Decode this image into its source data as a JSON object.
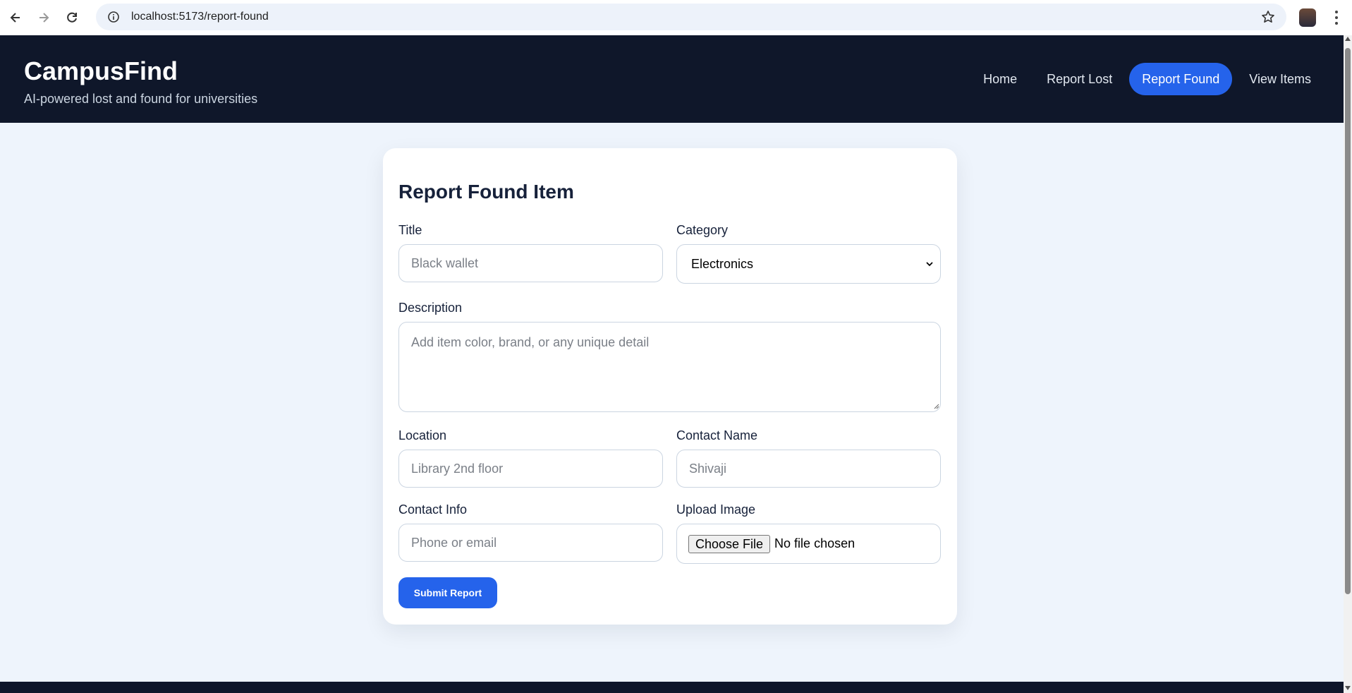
{
  "browser": {
    "url": "localhost:5173/report-found"
  },
  "header": {
    "brand": "CampusFind",
    "tagline": "AI-powered lost and found for universities",
    "nav": [
      {
        "label": "Home",
        "active": false
      },
      {
        "label": "Report Lost",
        "active": false
      },
      {
        "label": "Report Found",
        "active": true
      },
      {
        "label": "View Items",
        "active": false
      }
    ]
  },
  "form": {
    "heading": "Report Found Item",
    "title": {
      "label": "Title",
      "placeholder": "Black wallet"
    },
    "category": {
      "label": "Category",
      "value": "Electronics"
    },
    "description": {
      "label": "Description",
      "placeholder": "Add item color, brand, or any unique detail"
    },
    "location": {
      "label": "Location",
      "placeholder": "Library 2nd floor"
    },
    "contact_name": {
      "label": "Contact Name",
      "placeholder": "Shivaji"
    },
    "contact_info": {
      "label": "Contact Info",
      "placeholder": "Phone or email"
    },
    "upload": {
      "label": "Upload Image",
      "button": "Choose File",
      "status": "No file chosen"
    },
    "submit_label": "Submit Report"
  },
  "colors": {
    "header_bg": "#0f172a",
    "accent": "#2563eb",
    "page_bg": "#eef4fc"
  }
}
